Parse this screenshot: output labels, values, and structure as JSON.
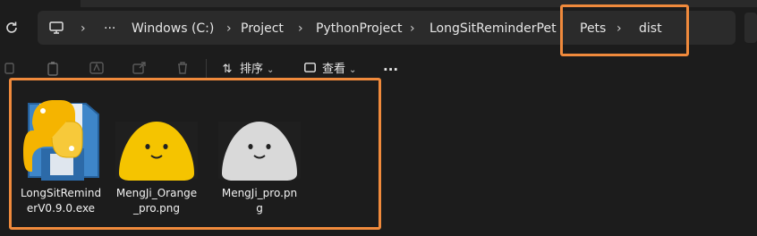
{
  "breadcrumbs": {
    "more_label": "···",
    "items": [
      "Windows (C:)",
      "Project",
      "PythonProject",
      "LongSitReminderPet",
      "Pets",
      "dist"
    ],
    "separator": ">"
  },
  "toolbar": {
    "sort_label": "排序",
    "view_label": "查看",
    "more_label": "···"
  },
  "files": [
    {
      "name_line1": "LongSitRemind",
      "name_line2": "erV0.9.0.exe",
      "icon": "python-executable-icon"
    },
    {
      "name_line1": "MengJi_Orange",
      "name_line2": "_pro.png",
      "icon": "orange-blob-image",
      "color": "#f5c400"
    },
    {
      "name_line1": "MengJi_pro.pn",
      "name_line2": "g",
      "icon": "gray-blob-image",
      "color": "#d9d9d9"
    }
  ],
  "colors": {
    "highlight": "#f08a3c",
    "background": "#1c1c1c"
  }
}
